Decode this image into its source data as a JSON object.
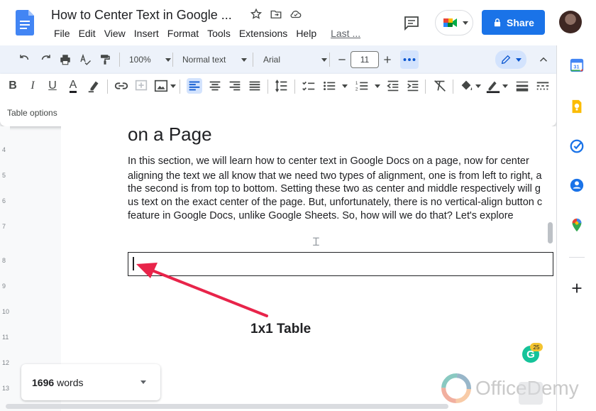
{
  "app": {
    "title": "How to Center Text in Google ...",
    "menu": [
      "File",
      "Edit",
      "View",
      "Insert",
      "Format",
      "Tools",
      "Extensions",
      "Help"
    ],
    "last_edit": "Last ...",
    "share_label": "Share"
  },
  "toolbar": {
    "zoom": "100%",
    "style": "Normal text",
    "font": "Arial",
    "font_size": "11",
    "table_options": "Table options"
  },
  "document": {
    "heading": "on a Page",
    "paragraph_lines": [
      "In this section, we will learn how to center text in Google Docs on a page, now for center",
      "aligning the text we all know that we need two types of alignment, one is from left to right, a",
      "the second is from top to bottom. Setting these two as center and middle respectively will g",
      "us text on the exact center of the page. But, unfortunately, there is no vertical-align button c",
      "feature in Google Docs, unlike Google Sheets. So, how will we do that? Let's explore"
    ],
    "annotation": "1x1 Table"
  },
  "ruler": [
    "4",
    "5",
    "6",
    "7",
    "8",
    "9",
    "10",
    "11",
    "12",
    "13"
  ],
  "word_count": {
    "count": "1696",
    "unit": "words"
  },
  "grammarly": {
    "letter": "G",
    "badge": "25"
  },
  "watermark": "OfficeDemy",
  "colors": {
    "accent": "#1a73e8",
    "annotation": "#e8244a",
    "toolbar_bg": "#edf2fa"
  }
}
